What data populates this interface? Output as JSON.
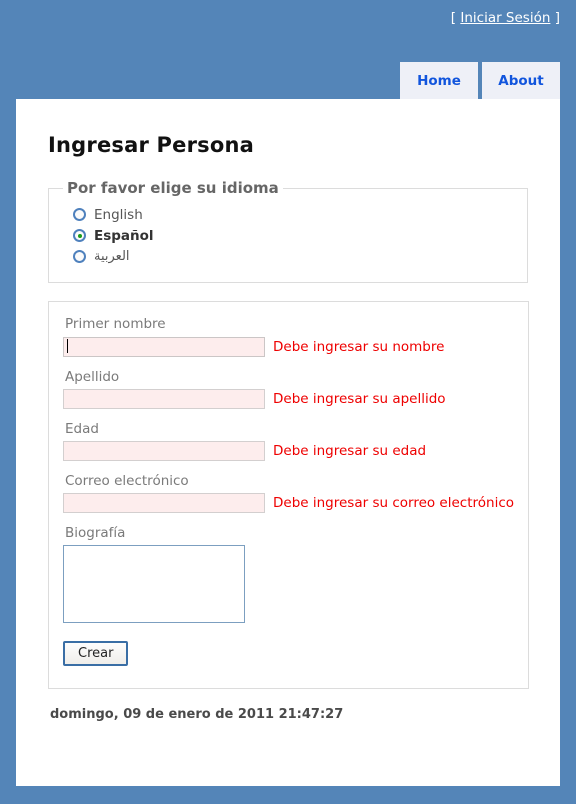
{
  "topbar": {
    "bracket_open": "[",
    "login_label": "Iniciar Sesión",
    "bracket_close": "]"
  },
  "nav": {
    "tabs": [
      {
        "label": "Home"
      },
      {
        "label": "About"
      }
    ]
  },
  "page": {
    "title": "Ingresar Persona",
    "timestamp": "domingo, 09 de enero de 2011 21:47:27"
  },
  "language": {
    "legend": "Por favor elige su idioma",
    "options": [
      {
        "label": "English",
        "selected": false
      },
      {
        "label": "Español",
        "selected": true
      },
      {
        "label": "العربية",
        "selected": false
      }
    ]
  },
  "form": {
    "fields": [
      {
        "label": "Primer nombre",
        "value": "",
        "placeholder": "",
        "error": "Debe ingresar su nombre",
        "focused": true
      },
      {
        "label": "Apellido",
        "value": "",
        "placeholder": "",
        "error": "Debe ingresar su apellido",
        "focused": false
      },
      {
        "label": "Edad",
        "value": "",
        "placeholder": "",
        "error": "Debe ingresar su edad",
        "focused": false
      },
      {
        "label": "Correo electrónico",
        "value": "",
        "placeholder": "",
        "error": "Debe ingresar su correo electrónico",
        "focused": false
      }
    ],
    "bio": {
      "label": "Biografía",
      "value": "",
      "placeholder": ""
    },
    "submit_label": "Crear"
  },
  "colors": {
    "page_background": "#5485b8",
    "panel_background": "#ffffff",
    "tab_background": "#eef0f7",
    "tab_text": "#1155dd",
    "error_text": "#ee0000",
    "input_background": "#fdeded",
    "radio_ring": "#4f81bd",
    "radio_dot": "#1a9c1a",
    "textarea_border": "#7c9fc0",
    "button_border": "#3a6ea5"
  }
}
